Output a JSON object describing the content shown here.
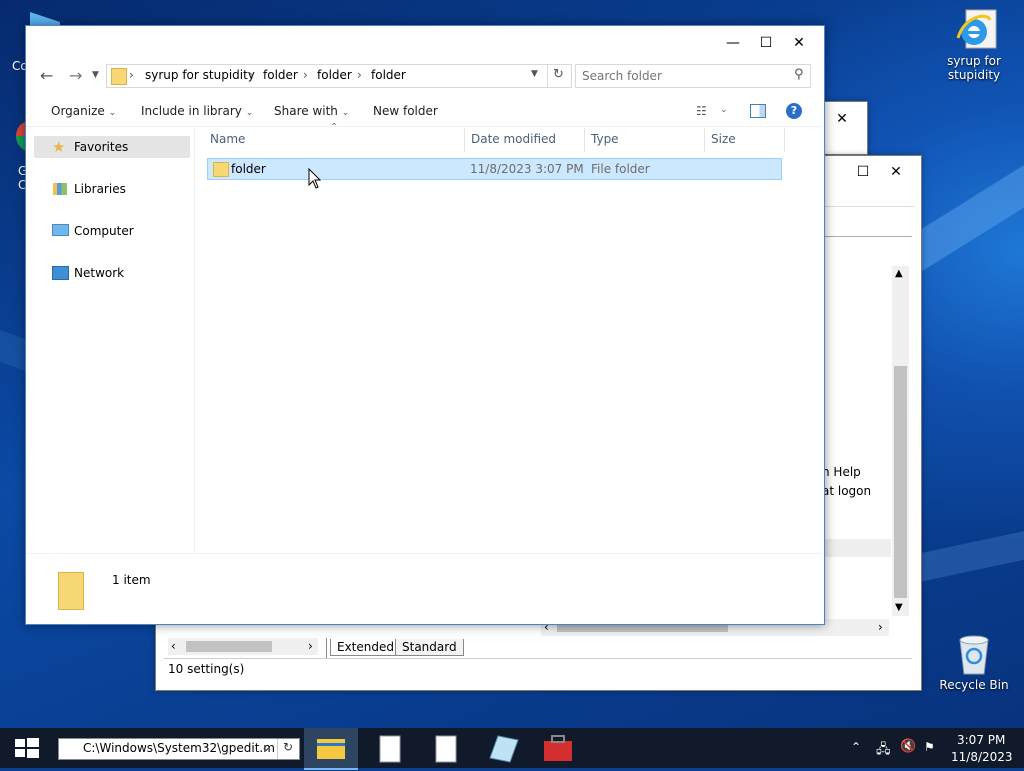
{
  "desktop": {
    "icons": [
      {
        "label_line1": "syrup for",
        "label_line2": "stupidity",
        "icon": "internet-explorer-icon"
      },
      {
        "label_line1": "Recycle Bin",
        "label_line2": "",
        "icon": "recycle-bin-icon"
      }
    ],
    "partial_left_1": "Co",
    "partial_left_2": "G",
    "partial_left_3": "C"
  },
  "bg_window": {
    "text_line1": "n Help",
    "text_line2": "at logon",
    "tabs": [
      "Extended",
      "Standard"
    ],
    "status": "10 setting(s)"
  },
  "explorer": {
    "breadcrumb": [
      "syrup for stupidity",
      "folder",
      "folder",
      "folder"
    ],
    "search_placeholder": "Search folder",
    "toolbar": {
      "organize": "Organize",
      "include_in_library": "Include in library",
      "share_with": "Share with",
      "new_folder": "New folder"
    },
    "nav": [
      "Favorites",
      "Libraries",
      "Computer",
      "Network"
    ],
    "columns": [
      "Name",
      "Date modified",
      "Type",
      "Size"
    ],
    "rows": [
      {
        "name": "folder",
        "date": "11/8/2023 3:07 PM",
        "type": "File folder",
        "size": ""
      }
    ],
    "status": "1 item"
  },
  "taskbar": {
    "run_box": "C:\\Windows\\System32\\gpedit.m",
    "time": "3:07 PM",
    "date": "11/8/2023"
  },
  "colors": {
    "selection": "#cce8ff",
    "selection_border": "#99d1ff",
    "taskbar": "#111a2a",
    "accent": "#4a84c7"
  }
}
